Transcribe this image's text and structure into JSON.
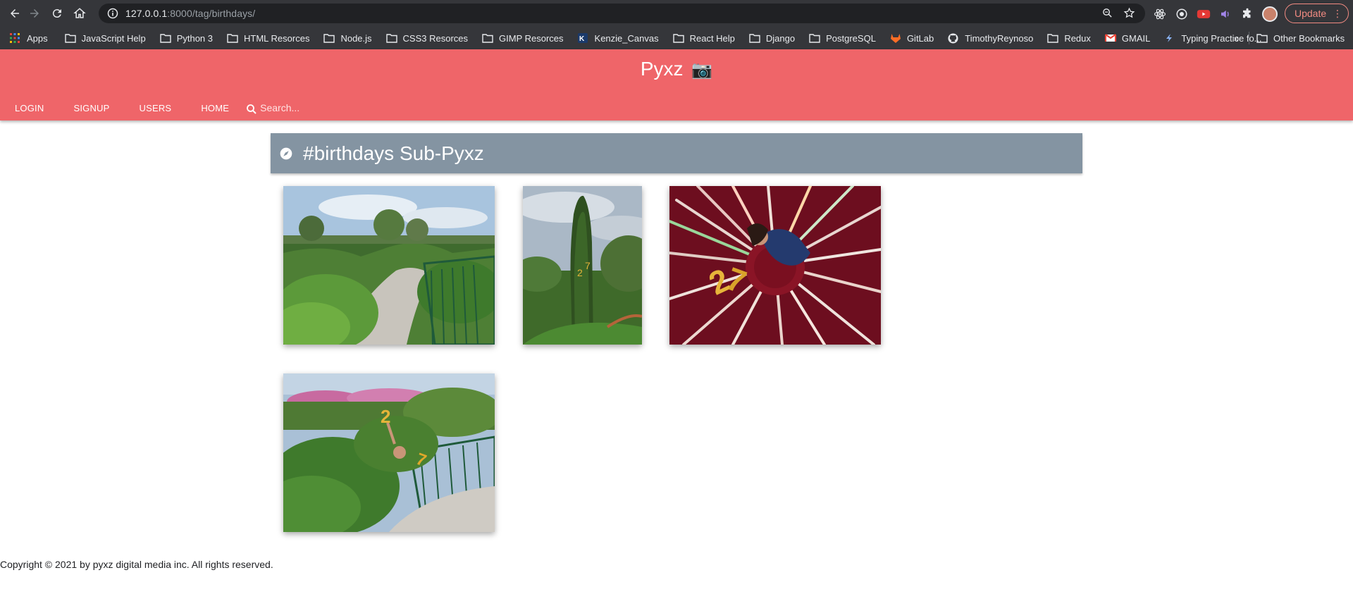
{
  "browser": {
    "url_host": "127.0.0.1",
    "url_path": ":8000/tag/birthdays/",
    "update_label": "Update",
    "bookmarks": [
      {
        "label": "Apps",
        "icon": "apps-grid-icon"
      },
      {
        "label": "JavaScript Help",
        "icon": "folder-icon"
      },
      {
        "label": "Python 3",
        "icon": "folder-icon"
      },
      {
        "label": "HTML Resorces",
        "icon": "folder-icon"
      },
      {
        "label": "Node.js",
        "icon": "folder-icon"
      },
      {
        "label": "CSS3 Resorces",
        "icon": "folder-icon"
      },
      {
        "label": "GIMP Resorces",
        "icon": "folder-icon"
      },
      {
        "label": "Kenzie_Canvas",
        "icon": "kenzie-icon"
      },
      {
        "label": "React Help",
        "icon": "folder-icon"
      },
      {
        "label": "Django",
        "icon": "folder-icon"
      },
      {
        "label": "PostgreSQL",
        "icon": "folder-icon"
      },
      {
        "label": "GitLab",
        "icon": "gitlab-icon"
      },
      {
        "label": "TimothyReynoso",
        "icon": "github-icon"
      },
      {
        "label": "Redux",
        "icon": "folder-icon"
      },
      {
        "label": "GMAIL",
        "icon": "gmail-icon"
      },
      {
        "label": "Typing Practice fo...",
        "icon": "typing-icon"
      }
    ],
    "overflow_label": "»",
    "other_bookmarks": "Other Bookmarks"
  },
  "site": {
    "brand": "Pyxz",
    "brand_icon": "📷",
    "nav": [
      "LOGIN",
      "SIGNUP",
      "USERS",
      "HOME"
    ],
    "search_placeholder": "Search...",
    "accent": "#ef6569",
    "banner_color": "#8494a2"
  },
  "page": {
    "title": "#birthdays Sub-Pyxz",
    "photos": [
      {
        "name": "photo-garden-hedge-maze"
      },
      {
        "name": "photo-topiary-tree"
      },
      {
        "name": "photo-balloons-starburst"
      },
      {
        "name": "photo-hedge-balloons"
      }
    ]
  },
  "footer": {
    "copyright": "Copyright © 2021 by pyxz digital media inc. All rights reserved."
  }
}
